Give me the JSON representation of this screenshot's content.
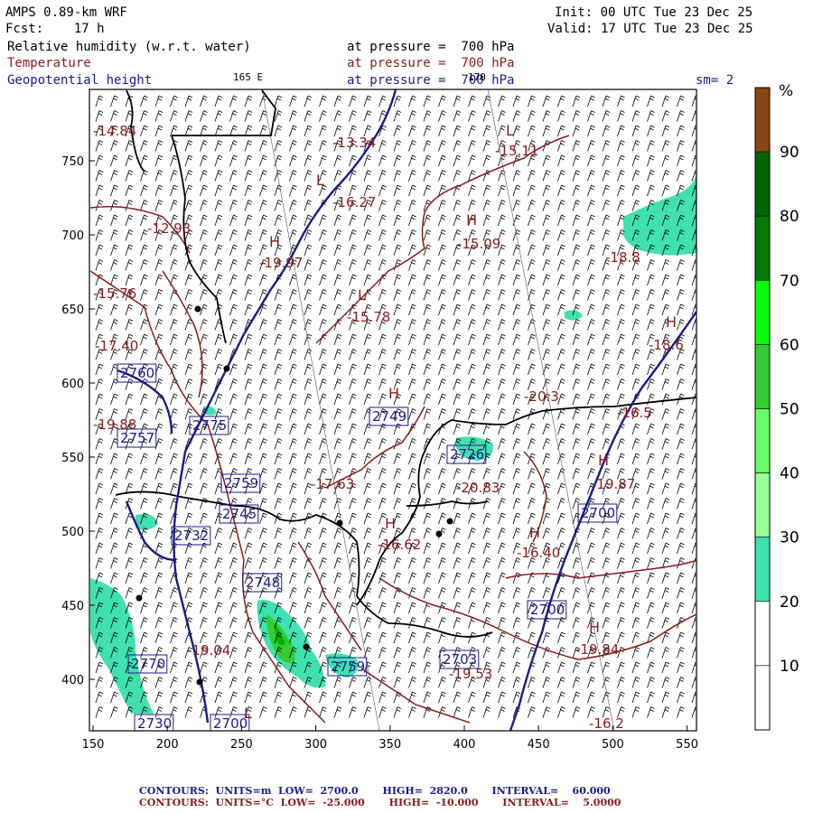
{
  "header": {
    "model": "AMPS 0.89-km WRF",
    "forecast": "Fcst:    17 h",
    "init": "Init: 00 UTC Tue 23 Dec 25",
    "valid": "Valid: 17 UTC Tue 23 Dec 25",
    "field1_name": "Relative humidity (w.r.t. water)",
    "field1_level": "at pressure =  700 hPa",
    "field2_name": "Temperature",
    "field2_level": "at pressure =  700 hPa",
    "field3_name": "Geopotential height",
    "field3_level": "at pressure =  700 hPa",
    "longitude_label": "165 E",
    "latitude_label": "170",
    "smoothing": "sm= 2"
  },
  "colorbar": {
    "unit": "%",
    "ticks": [
      "90",
      "80",
      "70",
      "60",
      "50",
      "40",
      "30",
      "20",
      "10"
    ],
    "bins": [
      {
        "min": 90,
        "max": 100,
        "color": "#8b4513"
      },
      {
        "min": 80,
        "max": 90,
        "color": "#006400"
      },
      {
        "min": 70,
        "max": 80,
        "color": "#007a00"
      },
      {
        "min": 60,
        "max": 70,
        "color": "#00ff00"
      },
      {
        "min": 50,
        "max": 60,
        "color": "#33cc33"
      },
      {
        "min": 40,
        "max": 50,
        "color": "#66ff66"
      },
      {
        "min": 30,
        "max": 40,
        "color": "#99ff99"
      },
      {
        "min": 20,
        "max": 30,
        "color": "#40e0b0"
      },
      {
        "min": 10,
        "max": 20,
        "color": "#ffffff"
      },
      {
        "min": 0,
        "max": 10,
        "color": "#ffffff"
      }
    ]
  },
  "axes": {
    "x_ticks": [
      "150",
      "200",
      "250",
      "300",
      "350",
      "400",
      "450",
      "500",
      "550"
    ],
    "y_ticks": [
      "750",
      "700",
      "650",
      "600",
      "550",
      "500",
      "450",
      "400"
    ]
  },
  "map_labels": {
    "blue_height_labels": [
      "2700",
      "2700",
      "2700",
      "2730",
      "2760",
      "2757",
      "2775",
      "2759",
      "2732",
      "2745",
      "2748",
      "2749",
      "2703",
      "2770",
      "2726",
      "2759"
    ],
    "red_temp_labels": [
      "-15.11",
      "-13.34",
      "-16.27",
      "-15.09",
      "-15.78",
      "-17.40",
      "-19.88",
      "-20.83",
      "-20.3",
      "-16.5",
      "-19.87",
      "-16.62",
      "-16.40",
      "-19.84",
      "-17.63",
      "-18.6",
      "-16.2",
      "-14.84",
      "-19.04",
      "-19.53",
      "-18.8",
      "-15.76",
      "-12.93",
      "-19.97"
    ],
    "hl_marks": [
      "H",
      "L"
    ]
  },
  "footer": {
    "line1": "CONTOURS:  UNITS=m  LOW=  2700.0       HIGH=  2820.0       INTERVAL=    60.000",
    "line2": "CONTOURS:  UNITS=°C  LOW=  -25.000       HIGH=  -10.000       INTERVAL=    5.0000"
  },
  "colors": {
    "height_contour": "#1a1a8c",
    "temp_contour": "#8b1a1a",
    "coast": "#000000",
    "humid": "#40e0b0"
  }
}
